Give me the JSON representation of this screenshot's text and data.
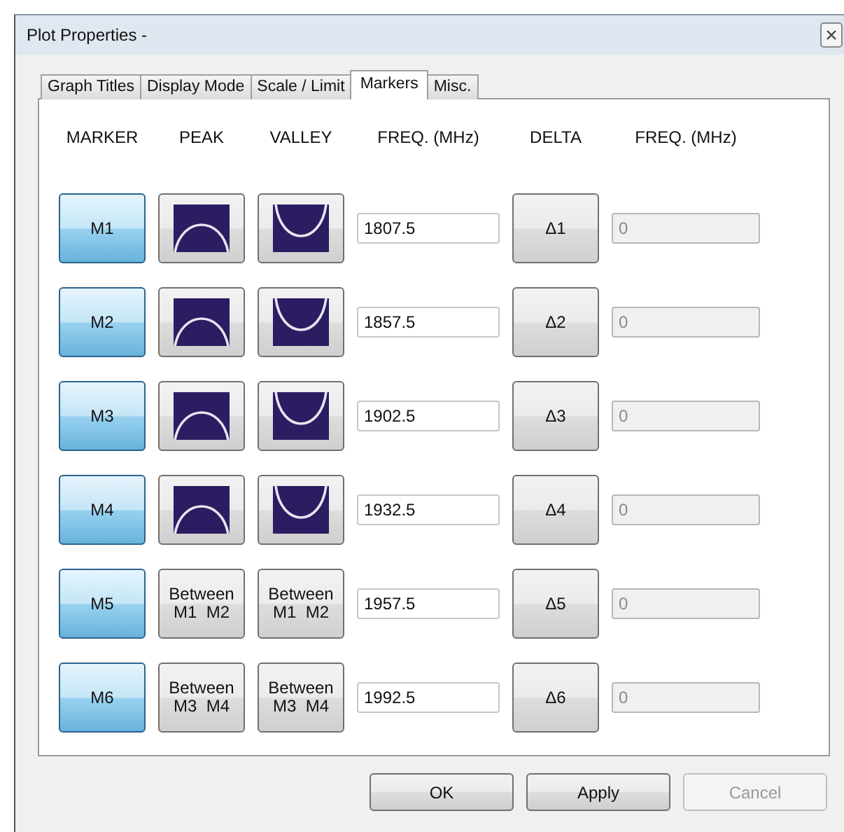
{
  "window": {
    "title": "Plot Properties -"
  },
  "tabs": [
    {
      "label": "Graph Titles",
      "selected": false
    },
    {
      "label": "Display Mode",
      "selected": false
    },
    {
      "label": "Scale / Limit",
      "selected": false
    },
    {
      "label": "Markers",
      "selected": true
    },
    {
      "label": "Misc.",
      "selected": false
    }
  ],
  "columns": [
    "MARKER",
    "PEAK",
    "VALLEY",
    "FREQ. (MHz)",
    "DELTA",
    "FREQ. (MHz)"
  ],
  "markers": [
    {
      "label": "M1",
      "on": true,
      "peak": {
        "kind": "curve"
      },
      "valley": {
        "kind": "curve"
      },
      "freq": "1807.5",
      "delta": "Δ1",
      "delta_freq": {
        "value": "0",
        "disabled": true
      }
    },
    {
      "label": "M2",
      "on": true,
      "peak": {
        "kind": "curve"
      },
      "valley": {
        "kind": "curve"
      },
      "freq": "1857.5",
      "delta": "Δ2",
      "delta_freq": {
        "value": "0",
        "disabled": true
      }
    },
    {
      "label": "M3",
      "on": true,
      "peak": {
        "kind": "curve"
      },
      "valley": {
        "kind": "curve"
      },
      "freq": "1902.5",
      "delta": "Δ3",
      "delta_freq": {
        "value": "0",
        "disabled": true
      }
    },
    {
      "label": "M4",
      "on": true,
      "peak": {
        "kind": "curve"
      },
      "valley": {
        "kind": "curve"
      },
      "freq": "1932.5",
      "delta": "Δ4",
      "delta_freq": {
        "value": "0",
        "disabled": true
      }
    },
    {
      "label": "M5",
      "on": true,
      "peak": {
        "kind": "text",
        "text": "Between\nM1  M2"
      },
      "valley": {
        "kind": "text",
        "text": "Between\nM1  M2"
      },
      "freq": "1957.5",
      "delta": "Δ5",
      "delta_freq": {
        "value": "0",
        "disabled": true
      }
    },
    {
      "label": "M6",
      "on": true,
      "peak": {
        "kind": "text",
        "text": "Between\nM3  M4"
      },
      "valley": {
        "kind": "text",
        "text": "Between\nM3  M4"
      },
      "freq": "1992.5",
      "delta": "Δ6",
      "delta_freq": {
        "value": "0",
        "disabled": true
      }
    }
  ],
  "buttons": [
    {
      "label": "OK",
      "disabled": false
    },
    {
      "label": "Apply",
      "disabled": false
    },
    {
      "label": "Cancel",
      "disabled": true
    }
  ]
}
